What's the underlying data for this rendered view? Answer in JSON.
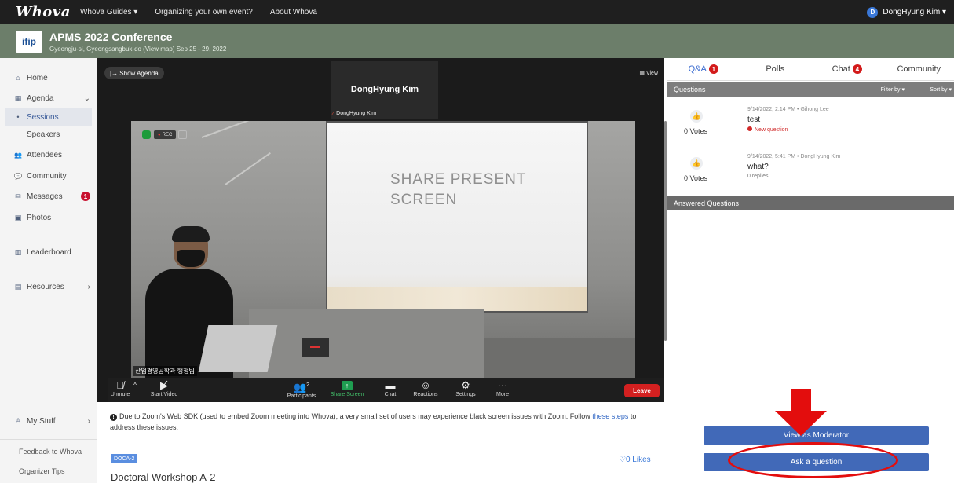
{
  "topbar": {
    "logo": "Whova",
    "nav": [
      "Whova Guides ▾",
      "Organizing your own event?",
      "About Whova"
    ],
    "user_initial": "D",
    "user_name": "DongHyung Kim ▾"
  },
  "event": {
    "logo_text": "ifip",
    "title": "APMS 2022 Conference",
    "subtitle": "Gyeongju-si, Gyeongsangbuk-do (View map)  Sep 25 - 29, 2022"
  },
  "sidebar": {
    "items": [
      {
        "label": "Home",
        "icon": "home-icon",
        "glyph": "⌂"
      },
      {
        "label": "Agenda",
        "icon": "calendar-icon",
        "glyph": "▦",
        "chev": "⌄"
      },
      {
        "label": "Sessions",
        "icon": "bullet-icon",
        "glyph": "•"
      },
      {
        "label": "Speakers"
      },
      {
        "label": "Attendees",
        "icon": "people-icon",
        "glyph": "👥"
      },
      {
        "label": "Community",
        "icon": "chat-bubbles-icon",
        "glyph": "💬"
      },
      {
        "label": "Messages",
        "icon": "mail-icon",
        "glyph": "✉",
        "badge": "1"
      },
      {
        "label": "Photos",
        "icon": "camera-icon",
        "glyph": "▣"
      },
      {
        "label": "Leaderboard",
        "icon": "leaderboard-icon",
        "glyph": "▥"
      },
      {
        "label": "Resources",
        "icon": "resources-icon",
        "glyph": "▤",
        "chev": "›"
      }
    ],
    "my_stuff": "My Stuff",
    "my_stuff_chev": "›",
    "feedback": "Feedback to Whova",
    "tips": "Organizer Tips"
  },
  "zoom": {
    "show_agenda": "|→ Show Agenda",
    "view": "▦ View",
    "speaker_name": "DongHyung Kim",
    "speaker_tag": "DongHyung Kim",
    "rec": "REC",
    "slide_text_1": "SHARE PRESENT",
    "slide_text_2": "SCREEN",
    "video_label": "산업경영공학과 행정팀",
    "toolbar": {
      "unmute": "Unmute",
      "start_video": "Start Video",
      "participants": "Participants",
      "participants_count": "2",
      "share_screen": "Share Screen",
      "chat": "Chat",
      "reactions": "Reactions",
      "settings": "Settings",
      "more": "More",
      "leave": "Leave"
    }
  },
  "notice": {
    "text_before": "Due to Zoom's Web SDK (used to embed Zoom meeting into Whova), a very small set of users may experience black screen issues with Zoom. Follow ",
    "link": "these steps",
    "text_after": " to address these issues."
  },
  "session": {
    "tag": "DOCA-2",
    "likes": "♡0 Likes",
    "title": "Doctoral Workshop A-2"
  },
  "panel": {
    "tabs": [
      {
        "label": "Q&A",
        "badge": "1"
      },
      {
        "label": "Polls"
      },
      {
        "label": "Chat",
        "badge": "4"
      },
      {
        "label": "Community"
      }
    ],
    "questions_header": "Questions",
    "filter": "Filter by ▾",
    "sort": "Sort by ▾",
    "questions": [
      {
        "votes": "0  Votes",
        "meta": "9/14/2022, 2:14 PM • Gihong Lee",
        "text": "test",
        "status": "New question"
      },
      {
        "votes": "0  Votes",
        "meta": "9/14/2022, 5:41 PM • DongHyung Kim",
        "text": "what?",
        "status": "0 replies"
      }
    ],
    "answered_header": "Answered Questions",
    "view_moderator": "View as Moderator",
    "ask_question": "Ask a question"
  },
  "colors": {
    "accent": "#4169b8",
    "annotation": "#e30d0d",
    "banner": "#6c7e6a"
  }
}
